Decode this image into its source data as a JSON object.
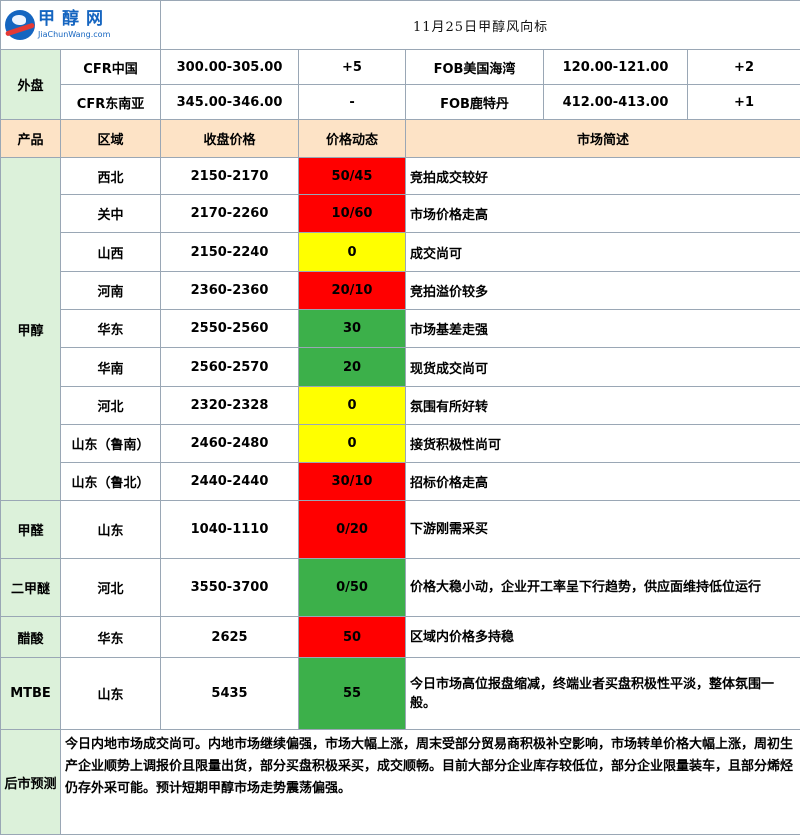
{
  "header": {
    "logo_text": "甲醇网",
    "logo_en": "JiaChunWang.com",
    "title": "11月25日甲醇风向标"
  },
  "external": {
    "label": "外盘",
    "rows": [
      {
        "left_name": "CFR中国",
        "left_price": "300.00-305.00",
        "left_change": "+5",
        "right_name": "FOB美国海湾",
        "right_price": "120.00-121.00",
        "right_change": "+2"
      },
      {
        "left_name": "CFR东南亚",
        "left_price": "345.00-346.00",
        "left_change": "-",
        "right_name": "FOB鹿特丹",
        "right_price": "412.00-413.00",
        "right_change": "+1"
      }
    ]
  },
  "columns": {
    "product": "产品",
    "region": "区域",
    "close_price": "收盘价格",
    "price_change": "价格动态",
    "market_summary": "市场简述"
  },
  "methanol": {
    "product": "甲醇",
    "rows": [
      {
        "region": "西北",
        "price": "2150-2170",
        "change": "50/45",
        "trend": "red",
        "summary": "竞拍成交较好"
      },
      {
        "region": "关中",
        "price": "2170-2260",
        "change": "10/60",
        "trend": "red",
        "summary": "市场价格走高"
      },
      {
        "region": "山西",
        "price": "2150-2240",
        "change": "0",
        "trend": "yellow",
        "summary": "成交尚可"
      },
      {
        "region": "河南",
        "price": "2360-2360",
        "change": "20/10",
        "trend": "red",
        "summary": "竞拍溢价较多"
      },
      {
        "region": "华东",
        "price": "2550-2560",
        "change": "30",
        "trend": "green",
        "summary": "市场基差走强"
      },
      {
        "region": "华南",
        "price": "2560-2570",
        "change": "20",
        "trend": "green",
        "summary": "现货成交尚可"
      },
      {
        "region": "河北",
        "price": "2320-2328",
        "change": "0",
        "trend": "yellow",
        "summary": "氛围有所好转"
      },
      {
        "region": "山东（鲁南）",
        "price": "2460-2480",
        "change": "0",
        "trend": "yellow",
        "summary": "接货积极性尚可"
      },
      {
        "region": "山东（鲁北）",
        "price": "2440-2440",
        "change": "30/10",
        "trend": "red",
        "summary": "招标价格走高"
      }
    ]
  },
  "derivatives": [
    {
      "product": "甲醛",
      "region": "山东",
      "price": "1040-1110",
      "change": "0/20",
      "trend": "red",
      "summary": "下游刚需采买"
    },
    {
      "product": "二甲醚",
      "region": "河北",
      "price": "3550-3700",
      "change": "0/50",
      "trend": "green",
      "summary": "价格大稳小动，企业开工率呈下行趋势，供应面维持低位运行"
    },
    {
      "product": "醋酸",
      "region": "华东",
      "price": "2625",
      "change": "50",
      "trend": "red",
      "summary": "区域内价格多持稳"
    },
    {
      "product": "MTBE",
      "region": "山东",
      "price": "5435",
      "change": "55",
      "trend": "green",
      "summary": "今日市场高位报盘缩减，终端业者买盘积极性平淡，整体氛围一般。"
    }
  ],
  "forecast": {
    "label": "后市预测",
    "text": "今日内地市场成交尚可。内地市场继续偏强，市场大幅上涨，周末受部分贸易商积极补空影响，市场转单价格大幅上涨，周初生产企业顺势上调报价且限量出货，部分买盘积极采买，成交顺畅。目前大部分企业库存较低位，部分企业限量装车，且部分烯烃仍存外采可能。预计短期甲醇市场走势震荡偏强。"
  },
  "colors": {
    "up": "#ff0000",
    "flat": "#ffff00",
    "down_green": "#3cb04a",
    "header_bg": "#fde3c6",
    "side_bg": "#dcf1da"
  }
}
